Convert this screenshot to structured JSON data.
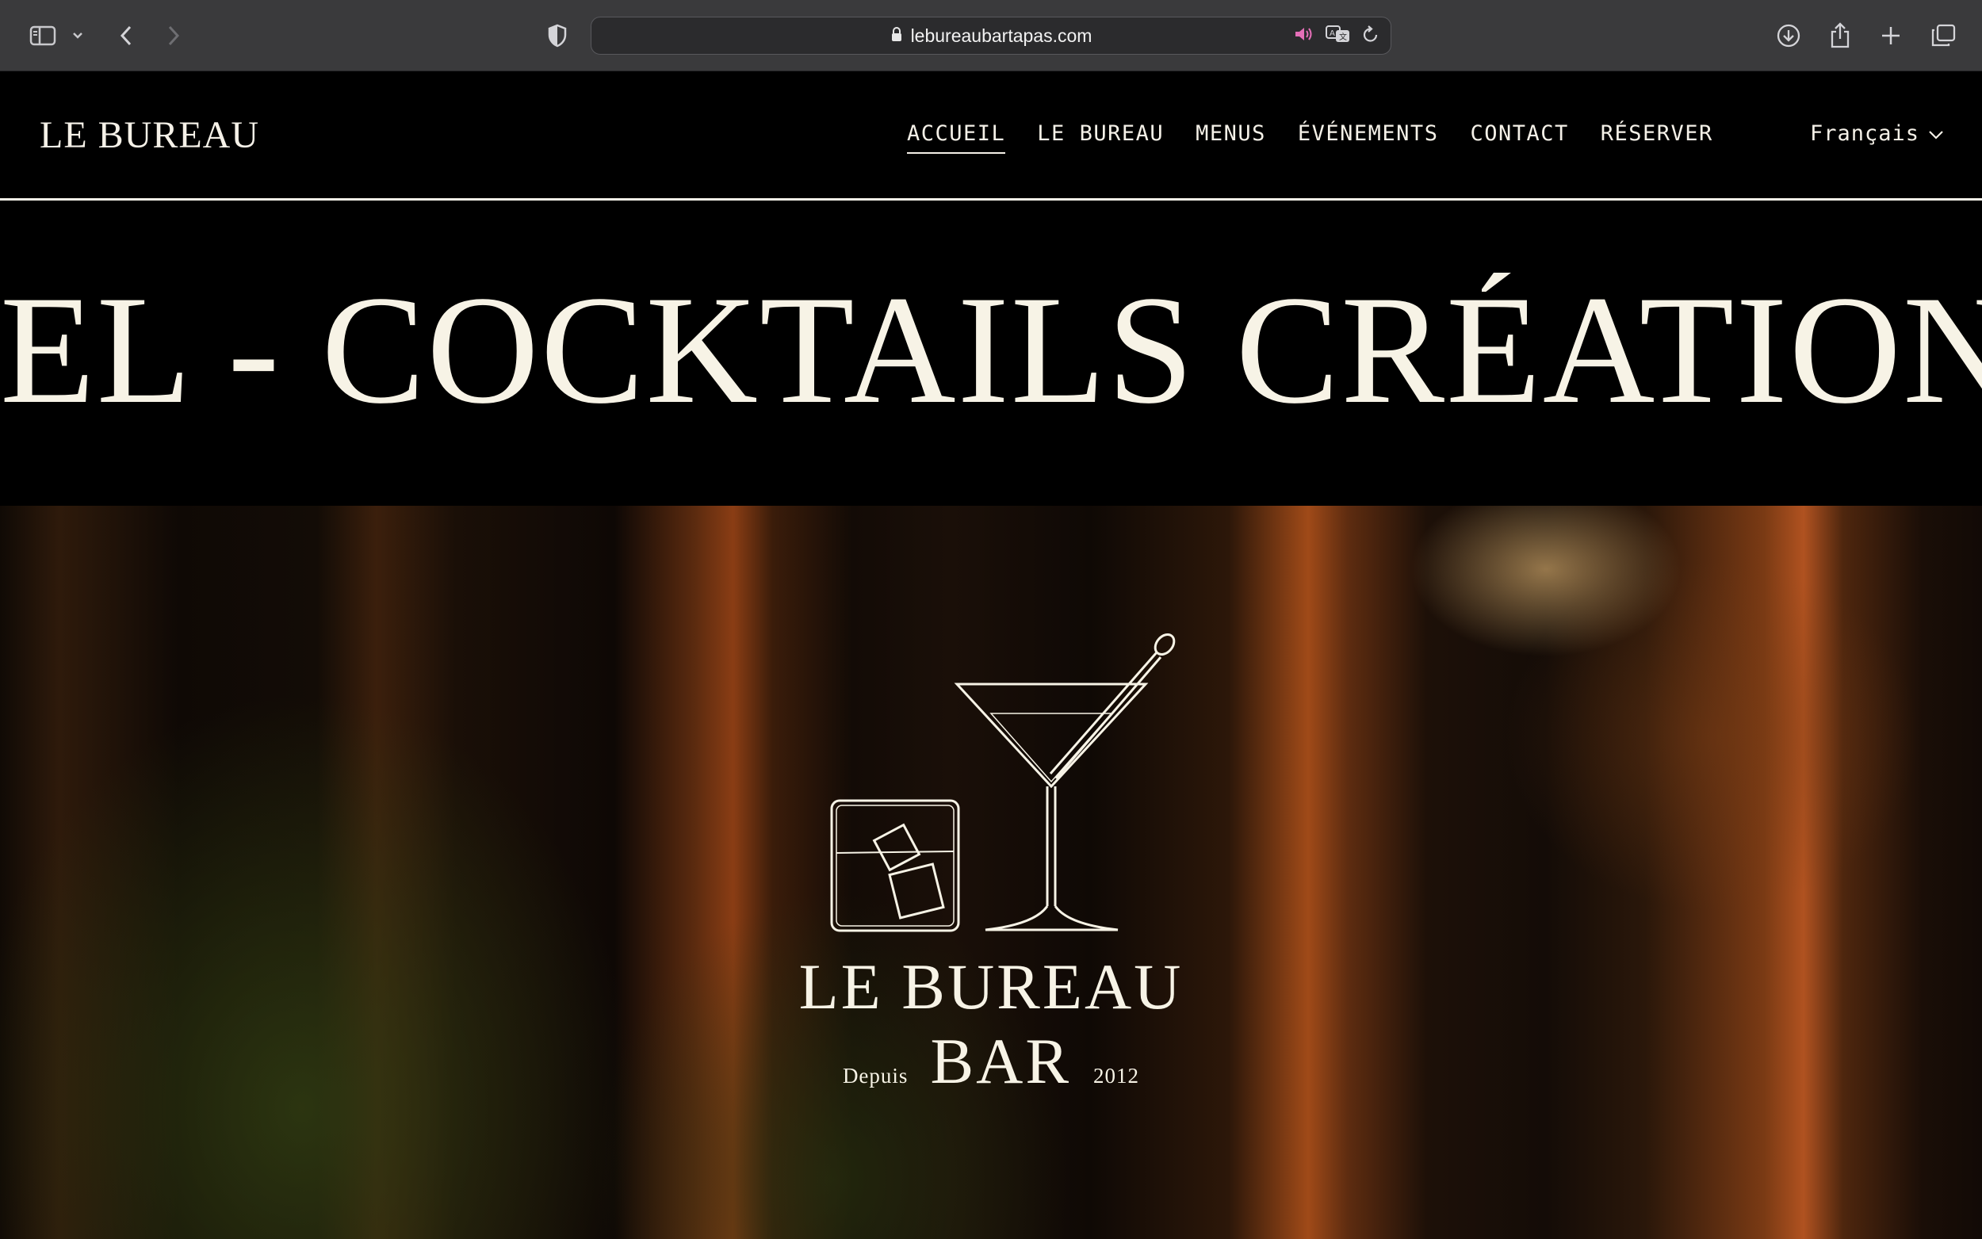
{
  "browser": {
    "url": "lebureaubartapas.com",
    "icons": [
      "sidebar-icon",
      "chevron-down-icon",
      "back-icon",
      "forward-icon",
      "privacy-shield-icon",
      "lock-icon",
      "speaker-icon",
      "translate-icon",
      "reload-icon",
      "download-icon",
      "share-icon",
      "new-tab-icon",
      "tabs-overview-icon"
    ],
    "speaker_color": "#e46fb7"
  },
  "header": {
    "logo": "LE BUREAU",
    "nav": [
      {
        "label": "ACCUEIL",
        "active": true
      },
      {
        "label": "LE BUREAU"
      },
      {
        "label": "MENUS"
      },
      {
        "label": "ÉVÉNEMENTS"
      },
      {
        "label": "CONTACT"
      },
      {
        "label": "RÉSERVER"
      }
    ],
    "language": "Français"
  },
  "marquee": {
    "text": "EL - COCKTAILS CRÉATIONS - VI"
  },
  "hero": {
    "title": "LE BUREAU",
    "depuis": "Depuis",
    "bar": "BAR",
    "year": "2012",
    "icons": [
      "rocks-glass-icon",
      "martini-glass-icon"
    ]
  },
  "colors": {
    "cream": "#f5f1e8",
    "background": "#000000",
    "toolbar": "#3a3a3c"
  }
}
